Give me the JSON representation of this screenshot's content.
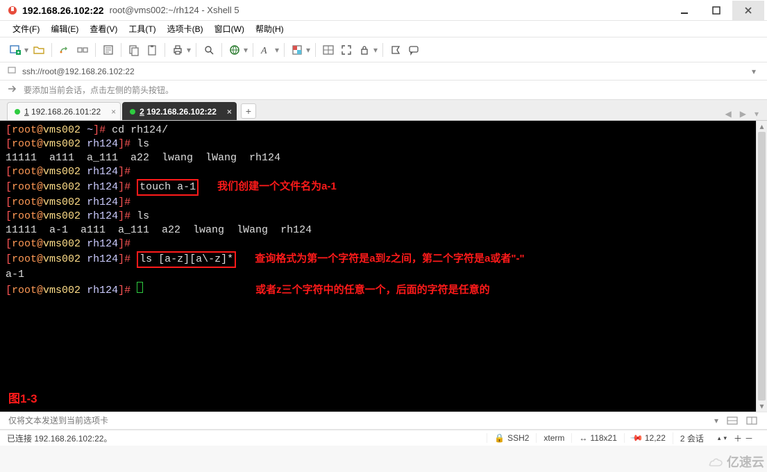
{
  "window": {
    "ip_title": "192.168.26.102:22",
    "session_title": "root@vms002:~/rh124 - Xshell 5"
  },
  "menu": {
    "file": "文件(F)",
    "edit": "编辑(E)",
    "view": "查看(V)",
    "tools": "工具(T)",
    "tab": "选项卡(B)",
    "window": "窗口(W)",
    "help": "帮助(H)"
  },
  "addressbar": {
    "value": "ssh://root@192.168.26.102:22"
  },
  "hint": {
    "text": "要添加当前会话，点击左侧的箭头按钮。"
  },
  "tabs": {
    "tab1": {
      "index": "1",
      "label": "192.168.26.101:22"
    },
    "tab2": {
      "index": "2",
      "label": "192.168.26.102:22"
    }
  },
  "terminal": {
    "prompt": {
      "user": "root",
      "host": "vms002",
      "path_home": "~",
      "path_dir": "rh124"
    },
    "cmds": {
      "cd": "cd rh124/",
      "ls": "ls",
      "touch": "touch a-1",
      "lsglob": "ls [a-z][a\\-z]*"
    },
    "outputs": {
      "ls1": "11111  a111  a_111  a22  lwang  lWang  rh124",
      "ls2": "11111  a-1  a111  a_111  a22  lwang  lWang  rh124",
      "glob": "a-1"
    },
    "annotations": {
      "touch_note": "我们创建一个文件名为a-1",
      "glob_note_1": "查询格式为第一个字符是a到z之间，第二个字符是a或者\"-\"",
      "glob_note_2": "或者z三个字符中的任意一个，后面的字符是任意的"
    },
    "figure_label": "图1-3"
  },
  "sendbar": {
    "placeholder": "仅将文本发送到当前选项卡"
  },
  "statusbar": {
    "connected": "已连接 192.168.26.102:22。",
    "proto": "SSH2",
    "term": "xterm",
    "size": "118x21",
    "pos": "12,22",
    "sessions": "2 会话"
  },
  "watermark": {
    "text": "亿速云"
  }
}
